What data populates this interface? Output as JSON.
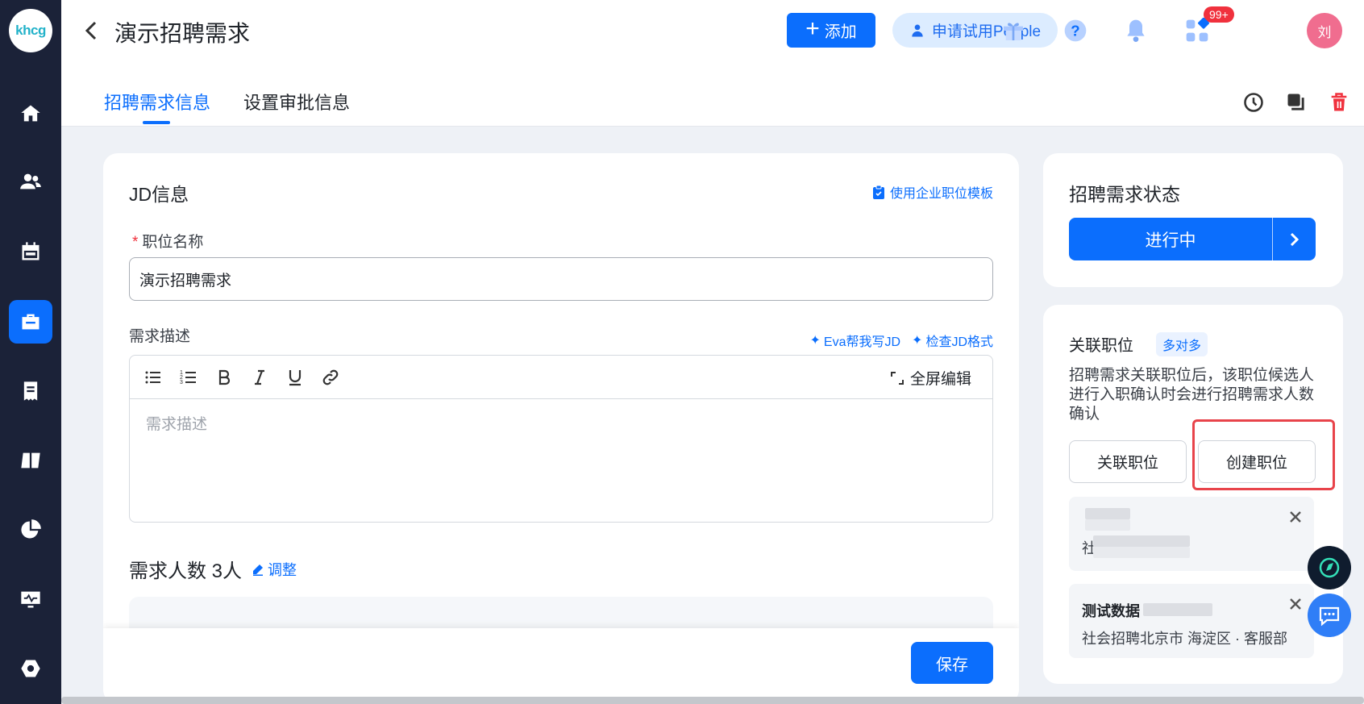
{
  "app": {
    "logo_text": "khcg"
  },
  "sidebar": {
    "items": [
      {
        "name": "home-icon"
      },
      {
        "name": "users-icon"
      },
      {
        "name": "calendar-icon"
      },
      {
        "name": "briefcase-icon"
      },
      {
        "name": "document-icon"
      },
      {
        "name": "book-icon"
      },
      {
        "name": "pie-chart-icon"
      },
      {
        "name": "monitor-icon"
      },
      {
        "name": "settings-icon"
      }
    ],
    "active_index": 3
  },
  "header": {
    "title": "演示招聘需求",
    "add_label": "添加",
    "trial_label": "申请试用People",
    "notification_badge": "99+",
    "avatar_text": "刘"
  },
  "tabs": [
    {
      "label": "招聘需求信息",
      "active": true
    },
    {
      "label": "设置审批信息",
      "active": false
    }
  ],
  "jd": {
    "section_title": "JD信息",
    "template_link": "使用企业职位模板",
    "position_label": "职位名称",
    "position_value": "演示招聘需求",
    "desc_label": "需求描述",
    "eva_link": "Eva帮我写JD",
    "check_link": "检查JD格式",
    "fullscreen_label": "全屏编辑",
    "desc_placeholder": "需求描述",
    "count_text": "需求人数 3人",
    "adjust_label": "调整",
    "save_label": "保存"
  },
  "status": {
    "title": "招聘需求状态",
    "value": "进行中"
  },
  "related": {
    "title": "关联职位",
    "tag": "多对多",
    "description": "招聘需求关联职位后，该职位候选人进行入职确认时会进行招聘需求人数确认",
    "link_button": "关联职位",
    "create_button": "创建职位",
    "jobs": [
      {
        "name": "",
        "meta": "社"
      },
      {
        "name": "测试数据",
        "meta": "社会招聘北京市 海淀区 · 客服部"
      }
    ]
  },
  "colors": {
    "primary": "#0b6efd",
    "sidebar_bg": "#1b2238",
    "highlight": "#e8434a",
    "danger": "#f0313d"
  }
}
